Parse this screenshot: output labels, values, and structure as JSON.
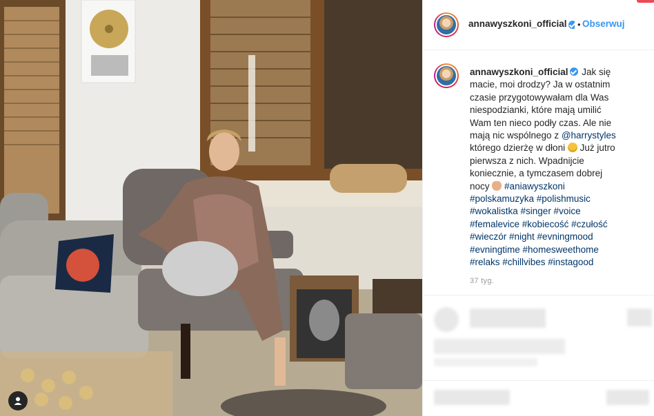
{
  "post": {
    "username": "annawyszkoni_official",
    "follow_label": "Obserwuj",
    "dot": "•",
    "caption": {
      "username": "annawyszkoni_official",
      "line1": " Jak się",
      "line2": "macie, moi drodzy? Ja w ostatnim",
      "line3": "czasie przygotowywałam dla Was",
      "line4": "niespodzianki, które mają umilić",
      "line5": "Wam ten nieco podły czas. Ale nie",
      "line6": "mają nic wspólnego z ",
      "mention": "@harrystyles",
      "line7a": "którego dzierżę w dłoni ",
      "line7b": " Już jutro",
      "line8": "pierwsza z nich. Wpadnijcie",
      "line9": "koniecznie, a tymczasem dobrej",
      "line10": "nocy ",
      "tags": [
        "#aniawyszkoni",
        "#polskamuzyka #polishmusic",
        "#wokalistka #singer #voice",
        "#femalevice #kobiecość #czułość",
        "#wieczór #night #evningmood",
        "#evningtime #homesweethome",
        "#relaks #chillvibes #instagood"
      ]
    },
    "time": "37 tyg."
  },
  "icons": {
    "verified": "verified-badge-icon",
    "user_tag": "user-tag-icon"
  },
  "colors": {
    "link": "#003569",
    "follow": "#3897f0",
    "text": "#262626"
  }
}
